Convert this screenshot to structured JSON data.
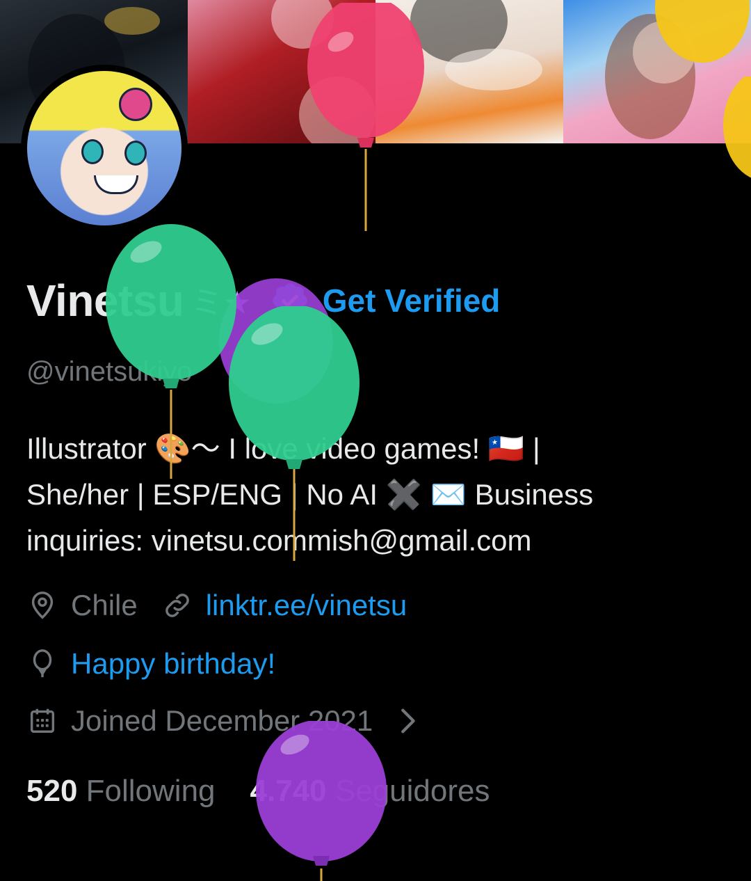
{
  "profile": {
    "display_name": "Vinetsu",
    "name_emoji": "ミ★",
    "get_verified_label": "Get Verified",
    "handle": "@vinetsukiyo",
    "bio_lines": [
      "Illustrator 🎨～ I love video games! 🇨🇱 |",
      "She/her | ESP/ENG |  No AI ✖️  ✉️ Business",
      "inquiries: vinetsu.commish@gmail.com"
    ],
    "location": "Chile",
    "website": "linktr.ee/vinetsu",
    "birthday": "Happy birthday!",
    "joined": "Joined December 2021"
  },
  "stats": {
    "following_count": "520",
    "following_label": "Following",
    "followers_count": "4.740",
    "followers_label": "Seguidores"
  },
  "icons": {
    "location": "location-pin-icon",
    "link": "link-icon",
    "birthday": "balloon-icon",
    "joined": "calendar-icon",
    "verified": "verified-badge-icon",
    "chevron": "chevron-right-icon"
  },
  "colors": {
    "accent": "#1d9bf0",
    "muted": "#71767b",
    "text": "#e7e9ea",
    "background": "#000000",
    "balloon_green": "#2ecc8f",
    "balloon_purple": "#9b3fd6",
    "balloon_pink": "#ef4170",
    "balloon_yellow": "#f5c518"
  }
}
